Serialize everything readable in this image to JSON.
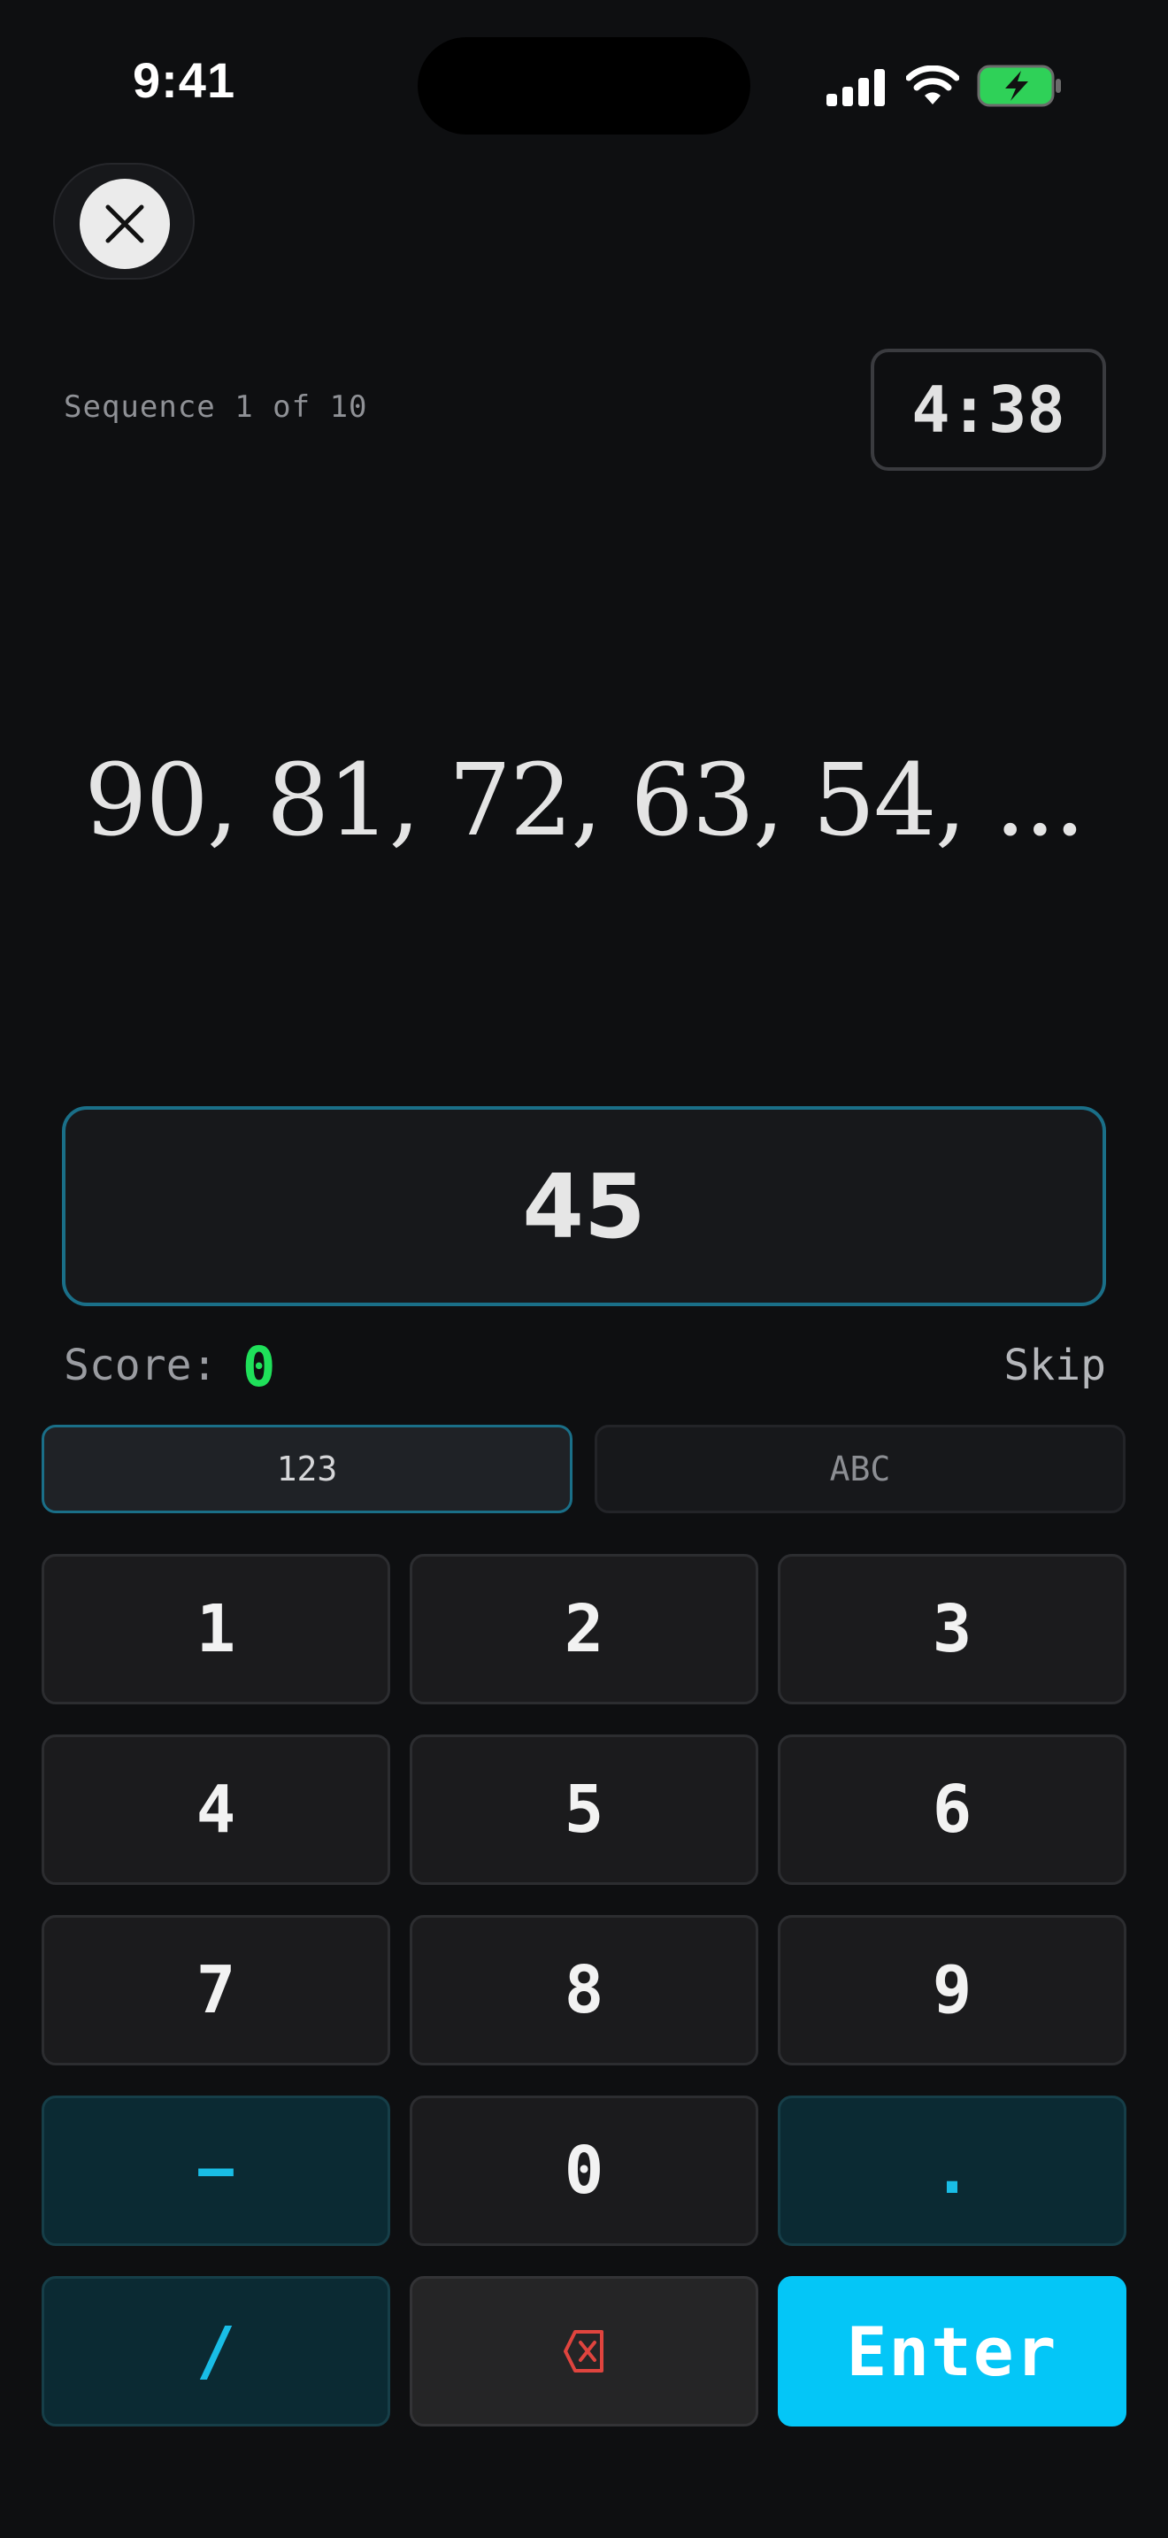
{
  "status_bar": {
    "time": "9:41",
    "icons": [
      "cellular-signal-icon",
      "wifi-icon",
      "battery-charging-icon"
    ],
    "battery_color": "#2fd158"
  },
  "header": {
    "close_icon": "close-icon",
    "sequence_label": "Sequence 1 of 10",
    "timer": "4:38"
  },
  "puzzle": {
    "sequence_text": "90, 81, 72, 63, 54, ..."
  },
  "answer": {
    "value": "45"
  },
  "score": {
    "label": "Score:",
    "value": "0",
    "value_color": "#1fe05a"
  },
  "skip_label": "Skip",
  "mode_tabs": [
    {
      "label": "123",
      "selected": true
    },
    {
      "label": "ABC",
      "selected": false
    }
  ],
  "keypad": {
    "keys": [
      "1",
      "2",
      "3",
      "4",
      "5",
      "6",
      "7",
      "8",
      "9",
      "−",
      "0",
      ".",
      "/"
    ],
    "backspace_icon": "backspace-icon",
    "enter_label": "Enter"
  },
  "colors": {
    "accent": "#04c6f7",
    "accent_border": "#1a6f88",
    "background": "#0e0f11",
    "delete_icon": "#e0443e"
  }
}
